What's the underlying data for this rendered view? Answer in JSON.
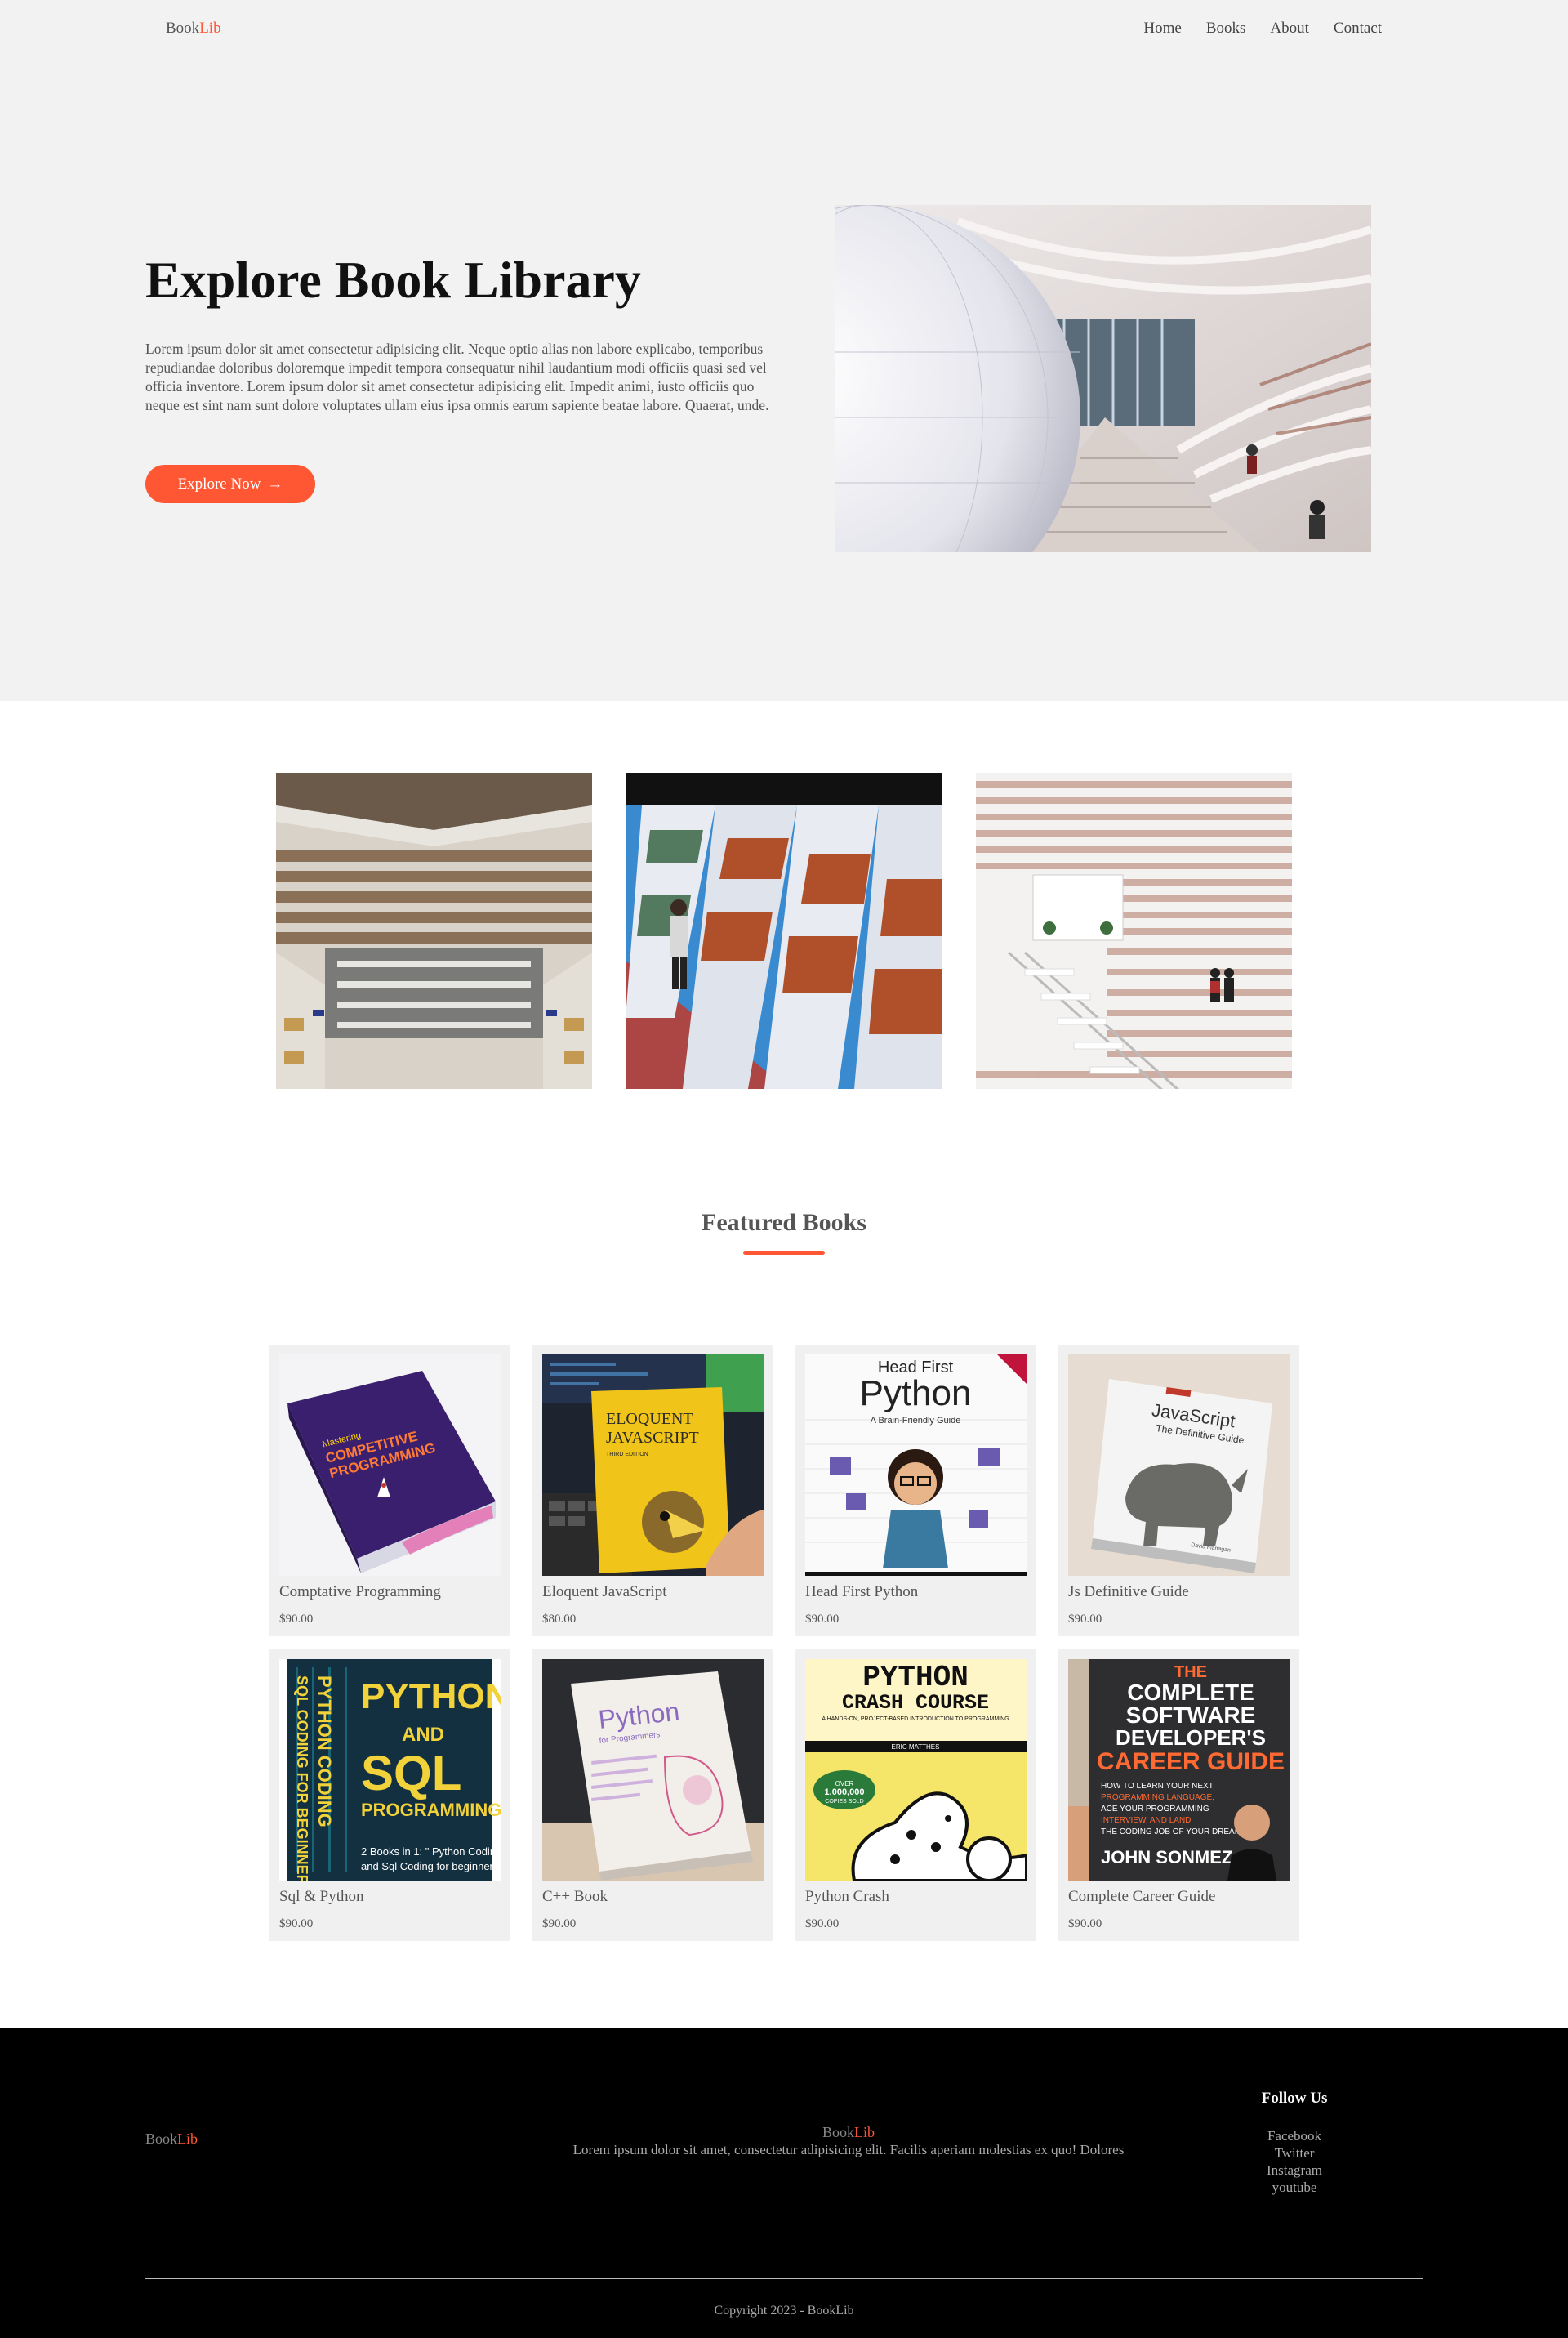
{
  "nav": {
    "brand_main": "Book",
    "brand_accent": "Lib",
    "links": [
      "Home",
      "Books",
      "About",
      "Contact"
    ]
  },
  "hero": {
    "title": "Explore Book Library",
    "text": "Lorem ipsum dolor sit amet consectetur adipisicing elit. Neque optio alias non labore explicabo, temporibus repudiandae doloribus doloremque impedit tempora consequatur nihil laudantium modi officiis quasi sed vel officia inventore. Lorem ipsum dolor sit amet consectetur adipisicing elit. Impedit animi, iusto officiis quo neque est sint nam sunt dolore voluptates ullam eius ipsa omnis earum sapiente beatae labore. Quaerat, unde.",
    "button_label": "Explore Now",
    "button_icon": "→"
  },
  "featured": {
    "title": "Featured Books",
    "books": [
      {
        "name": "Comptative Programming",
        "price": "$90.00",
        "cover": "competitive-programming-cover"
      },
      {
        "name": "Eloquent JavaScript",
        "price": "$80.00",
        "cover": "eloquent-javascript-cover"
      },
      {
        "name": "Head First Python",
        "price": "$90.00",
        "cover": "head-first-python-cover"
      },
      {
        "name": "Js Definitive Guide",
        "price": "$90.00",
        "cover": "js-definitive-guide-cover"
      },
      {
        "name": "Sql & Python",
        "price": "$90.00",
        "cover": "sql-python-cover"
      },
      {
        "name": "C++ Book",
        "price": "$90.00",
        "cover": "cpp-book-cover"
      },
      {
        "name": "Python Crash",
        "price": "$90.00",
        "cover": "python-crash-cover"
      },
      {
        "name": "Complete Career Guide",
        "price": "$90.00",
        "cover": "career-guide-cover"
      }
    ]
  },
  "footer": {
    "brand_main": "Book",
    "brand_accent": "Lib",
    "text": "Lorem ipsum dolor sit amet, consectetur adipisicing elit. Facilis aperiam molestias ex quo! Dolores",
    "follow_title": "Follow Us",
    "social_links": [
      "Facebook",
      "Twitter",
      "Instagram",
      "youtube"
    ],
    "copyright": "Copyright 2023 - BookLib"
  },
  "colors": {
    "accent": "#ff5733",
    "hero_bg": "#f2f2f2",
    "card_bg": "#f0f0f0",
    "footer_bg": "#000000"
  }
}
